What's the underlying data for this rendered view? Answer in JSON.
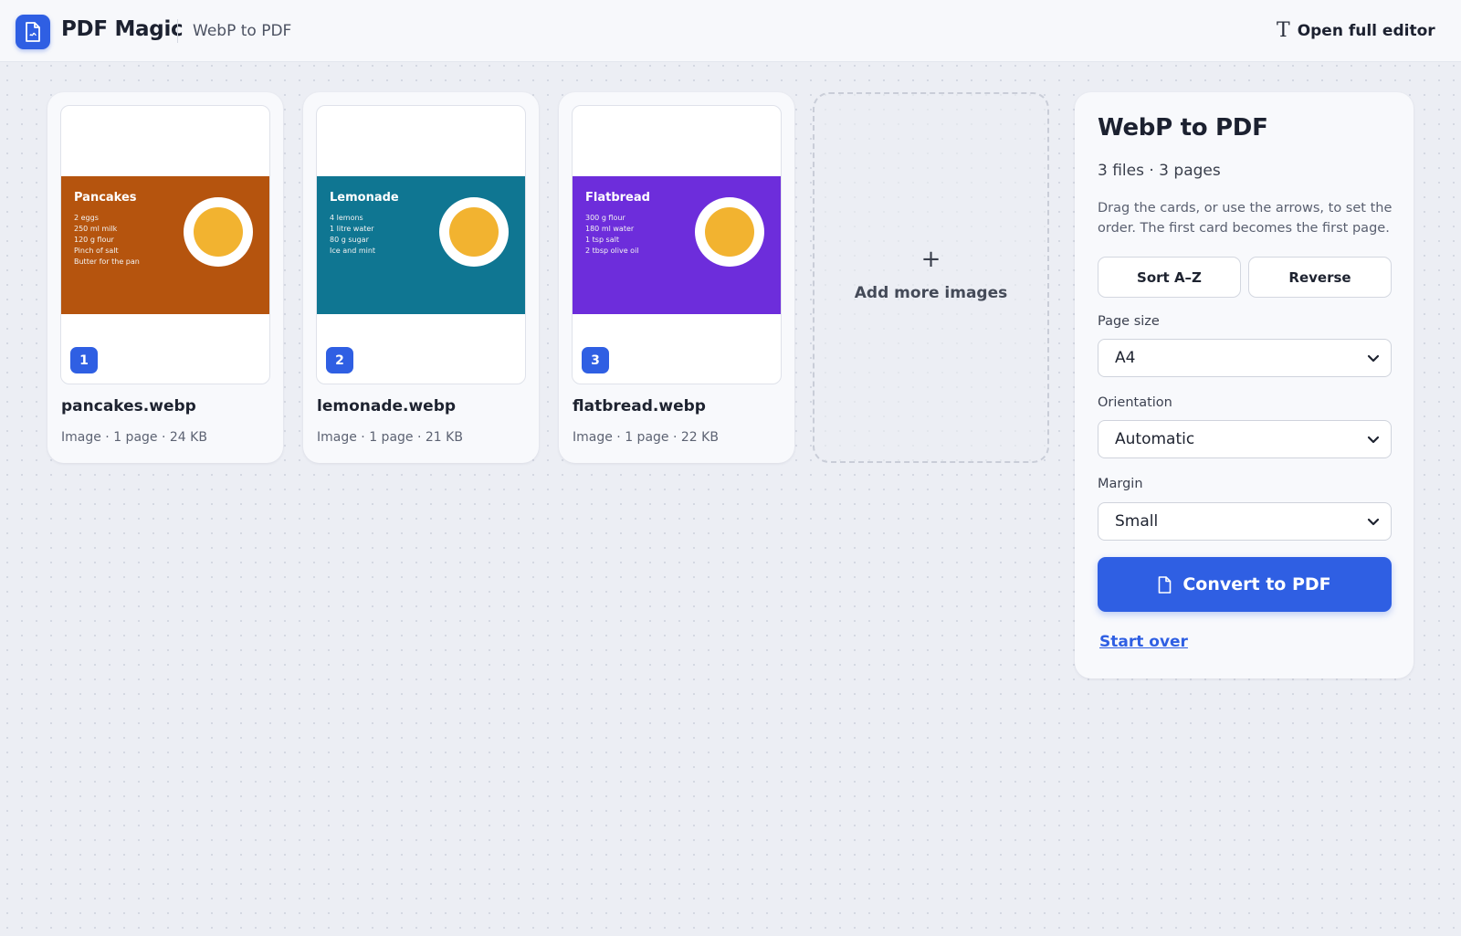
{
  "header": {
    "brand": "PDF Magic",
    "subtitle": "WebP to PDF",
    "editor_button": "Open full editor",
    "editor_icon": "text-icon"
  },
  "files": [
    {
      "order": "1",
      "name": "pancakes.webp",
      "meta": "Image · 1 page · 24 KB",
      "thumb_title": "Pancakes",
      "thumb_lines": [
        "2 eggs",
        "250 ml milk",
        "120 g flour",
        "Pinch of salt",
        "Butter for the pan"
      ],
      "color": "#b5540e"
    },
    {
      "order": "2",
      "name": "lemonade.webp",
      "meta": "Image · 1 page · 21 KB",
      "thumb_title": "Lemonade",
      "thumb_lines": [
        "4 lemons",
        "1 litre water",
        "80 g sugar",
        "Ice and mint"
      ],
      "color": "#0f7692"
    },
    {
      "order": "3",
      "name": "flatbread.webp",
      "meta": "Image · 1 page · 22 KB",
      "thumb_title": "Flatbread",
      "thumb_lines": [
        "300 g flour",
        "180 ml water",
        "1 tsp salt",
        "2 tbsp olive oil"
      ],
      "color": "#6d2ddb"
    }
  ],
  "add_tile": {
    "plus": "+",
    "label": "Add more images"
  },
  "panel": {
    "title": "WebP to PDF",
    "count": "3 files · 3 pages",
    "help": "Drag the cards, or use the arrows, to set the order. The first card becomes the first page.",
    "sort_button": "Sort A–Z",
    "reverse_button": "Reverse",
    "page_size": {
      "label": "Page size",
      "value": "A4"
    },
    "orientation": {
      "label": "Orientation",
      "value": "Automatic"
    },
    "margin": {
      "label": "Margin",
      "value": "Small"
    },
    "convert_button": "Convert to PDF",
    "start_over": "Start over"
  },
  "colors": {
    "accent": "#2f5fe3",
    "plate_yolk": "#f2b330"
  }
}
